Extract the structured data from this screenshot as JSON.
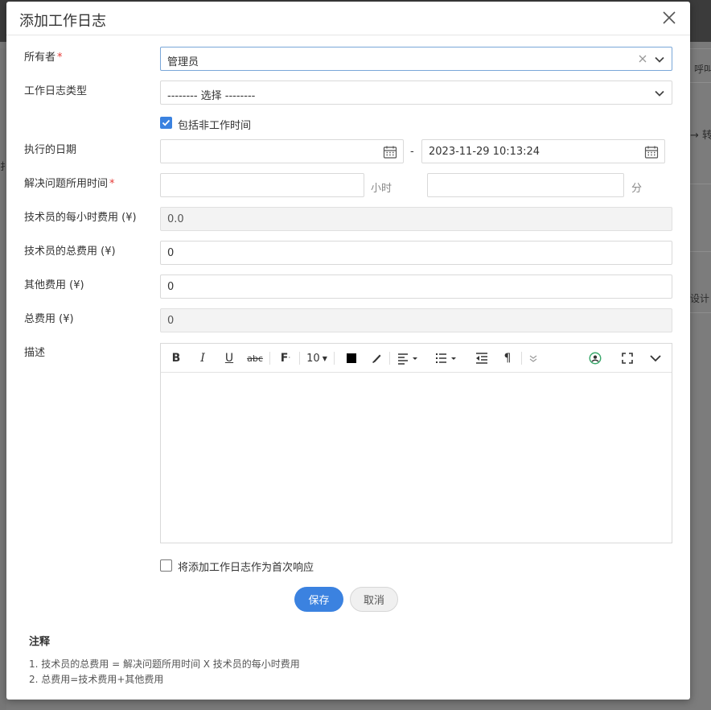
{
  "background": {
    "right_text_1": "呼叫",
    "right_text_2": "→ 转",
    "right_text_3": "设计",
    "left_text": "扌"
  },
  "dialog": {
    "title": "添加工作日志",
    "close_icon": "close-icon"
  },
  "form": {
    "owner": {
      "label": "所有者",
      "required_mark": "*",
      "value": "管理员"
    },
    "log_type": {
      "label": "工作日志类型",
      "value": "-------- 选择 --------"
    },
    "include_nonwork": {
      "label": "包括非工作时间",
      "checked": true
    },
    "exec_date": {
      "label": "执行的日期",
      "start_value": "",
      "separator": "-",
      "end_value": "2023-11-29 10:13:24"
    },
    "time_spent": {
      "label": "解决问题所用时间",
      "required_mark": "*",
      "hours_value": "",
      "hours_unit": "小时",
      "minutes_value": "",
      "minutes_unit": "分"
    },
    "hourly_cost": {
      "label": "技术员的每小时费用 (¥)",
      "value": "0.0"
    },
    "tech_total_cost": {
      "label": "技术员的总费用 (¥)",
      "value": "0"
    },
    "other_cost": {
      "label": "其他费用 (¥)",
      "value": "0"
    },
    "total_cost": {
      "label": "总费用 (¥)",
      "value": "0"
    },
    "description": {
      "label": "描述",
      "font_size": "10"
    },
    "first_response": {
      "label": "将添加工作日志作为首次响应",
      "checked": false
    }
  },
  "buttons": {
    "save": "保存",
    "cancel": "取消"
  },
  "notes": {
    "title": "注释",
    "items": [
      "1. 技术员的总费用 = 解决问题所用时间 X 技术员的每小时费用",
      "2. 总费用=技术费用+其他费用"
    ]
  },
  "colors": {
    "accent": "#3b82e0",
    "required": "#e53935",
    "readonly_bg": "#f3f3f3"
  }
}
